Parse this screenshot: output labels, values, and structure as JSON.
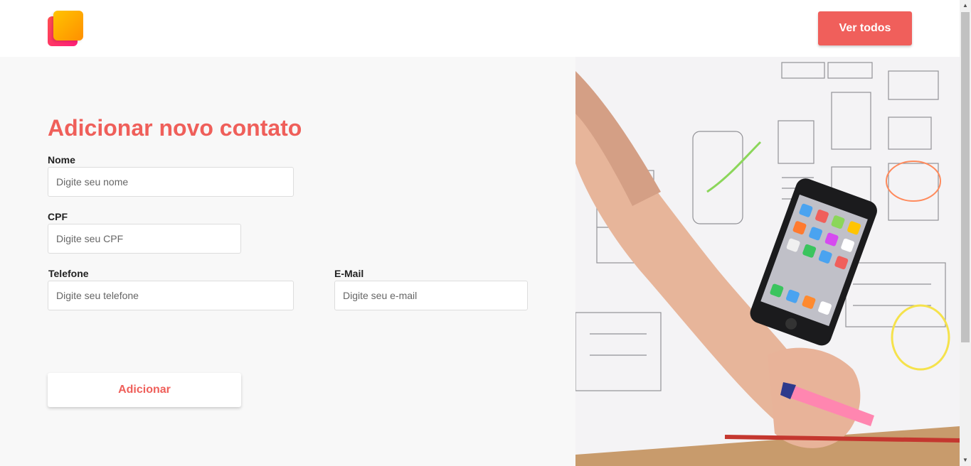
{
  "header": {
    "logo_name": "app-logo",
    "ver_todos_label": "Ver todos"
  },
  "form": {
    "title": "Adicionar novo contato",
    "nome": {
      "label": "Nome",
      "placeholder": "Digite seu nome"
    },
    "cpf": {
      "label": "CPF",
      "placeholder": "Digite seu CPF"
    },
    "telefone": {
      "label": "Telefone",
      "placeholder": "Digite seu telefone"
    },
    "email": {
      "label": "E-Mail",
      "placeholder": "Digite seu e-mail"
    },
    "submit_label": "Adicionar"
  },
  "colors": {
    "accent": "#f05f5b",
    "page_background": "#f8f8f8",
    "header_background": "#ffffff"
  },
  "photo": {
    "description_icon": "hand-with-phone-and-wireframes-photo"
  }
}
